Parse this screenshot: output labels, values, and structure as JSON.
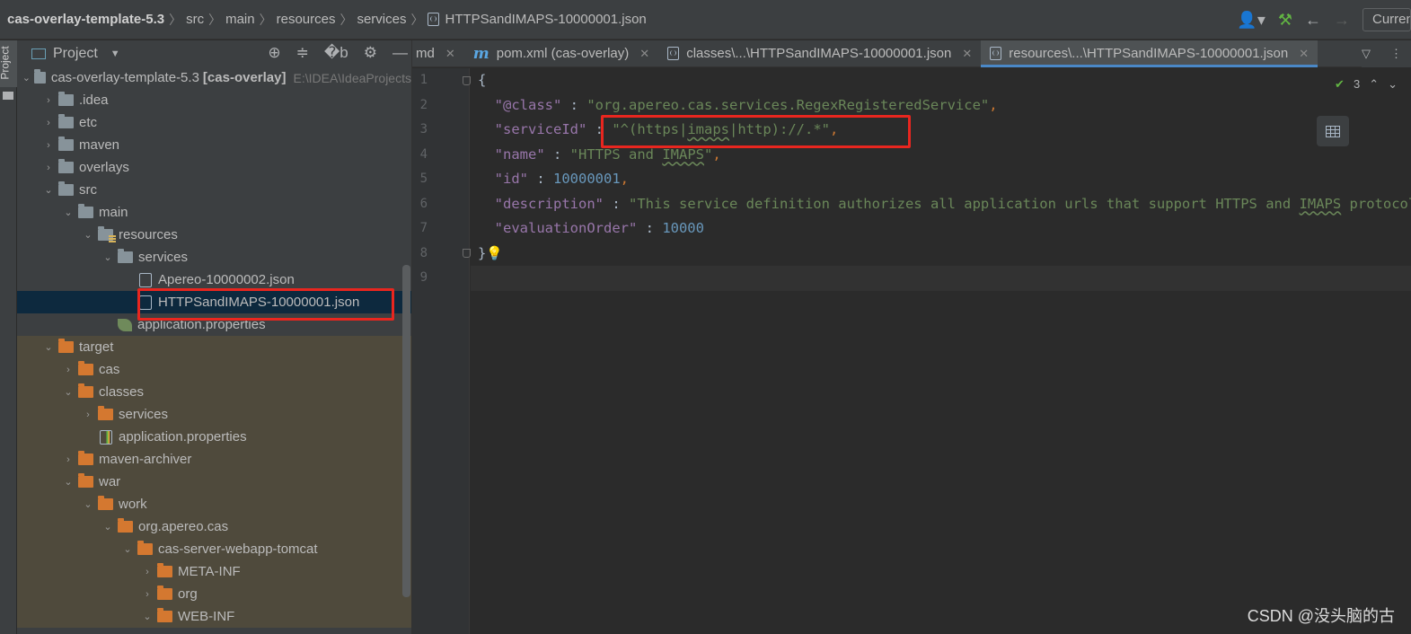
{
  "breadcrumb": {
    "project": "cas-overlay-template-5.3",
    "items": [
      "src",
      "main",
      "resources",
      "services"
    ],
    "file": "HTTPSandIMAPS-10000001.json"
  },
  "toolbar": {
    "config_label": "Current File"
  },
  "side_strip": {
    "label": "Project"
  },
  "project_panel": {
    "title": "Project",
    "tree": {
      "root_name": "cas-overlay-template-5.3",
      "root_module": "[cas-overlay]",
      "root_path": "E:\\IDEA\\IdeaProjects",
      "idea": ".idea",
      "etc": "etc",
      "maven": "maven",
      "overlays": "overlays",
      "src": "src",
      "main": "main",
      "resources": "resources",
      "services": "services",
      "apereo_json": "Apereo-10000002.json",
      "https_json": "HTTPSandIMAPS-10000001.json",
      "app_props": "application.properties",
      "target": "target",
      "cas": "cas",
      "classes": "classes",
      "classes_services": "services",
      "classes_app_props": "application.properties",
      "maven_archiver": "maven-archiver",
      "war": "war",
      "work": "work",
      "org_apereo_cas": "org.apereo.cas",
      "webapp": "cas-server-webapp-tomcat",
      "meta_inf": "META-INF",
      "org": "org",
      "web_inf": "WEB-INF"
    }
  },
  "tabs": [
    {
      "label": "md"
    },
    {
      "label": "pom.xml (cas-overlay)"
    },
    {
      "label": "classes\\...\\HTTPSandIMAPS-10000001.json"
    },
    {
      "label": "resources\\...\\HTTPSandIMAPS-10000001.json"
    }
  ],
  "editor": {
    "line_numbers": [
      "1",
      "2",
      "3",
      "4",
      "5",
      "6",
      "7",
      "8",
      "9"
    ],
    "inspection_count": "3",
    "code": {
      "l1": "{",
      "class_key": "\"@class\"",
      "class_val": "\"org.apereo.cas.services.RegexRegisteredService\"",
      "sid_key": "\"serviceId\"",
      "sid_v1": "\"^(https|",
      "sid_v2": "imaps",
      "sid_v3": "|http)://.*\"",
      "name_key": "\"name\"",
      "name_v1": "\"HTTPS and ",
      "name_v2": "IMAPS",
      "name_v3": "\"",
      "id_key": "\"id\"",
      "id_val": "10000001",
      "desc_key": "\"description\"",
      "desc_v1": "\"This service definition authorizes all application urls that support HTTPS and ",
      "desc_v2": "IMAPS",
      "desc_v3": " protocols.\"",
      "order_key": "\"evaluationOrder\"",
      "order_val": "10000",
      "l8": "}"
    }
  },
  "watermark": "CSDN @没头脑的古",
  "colors": {
    "highlight_box": "#e8261f",
    "selection": "#0d293e",
    "accent": "#4a88c7"
  },
  "icons": [
    "user-icon",
    "hammer-icon",
    "back-arrow-icon",
    "forward-arrow-icon",
    "crosshair-icon",
    "expand-all-icon",
    "collapse-all-icon",
    "gear-icon",
    "minimize-icon",
    "table-icon",
    "bulb-icon",
    "check-icon"
  ]
}
